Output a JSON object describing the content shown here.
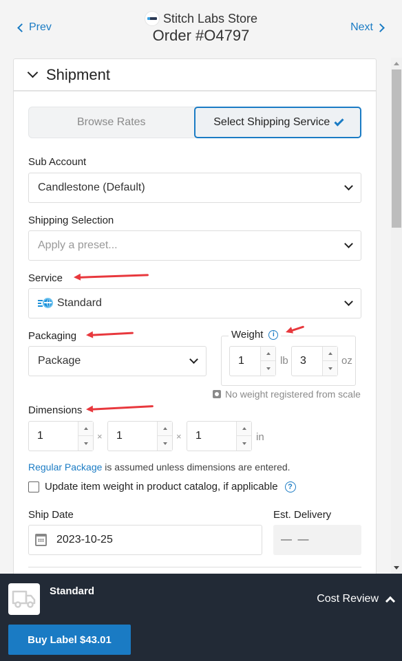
{
  "header": {
    "prev_label": "Prev",
    "next_label": "Next",
    "store_name": "Stitch Labs Store",
    "order_title": "Order #O4797"
  },
  "panel": {
    "title": "Shipment",
    "tabs": [
      {
        "label": "Browse Rates",
        "active": false
      },
      {
        "label": "Select Shipping Service",
        "active": true
      }
    ]
  },
  "form": {
    "sub_account": {
      "label": "Sub Account",
      "value": "Candlestone (Default)"
    },
    "shipping_selection": {
      "label": "Shipping Selection",
      "placeholder": "Apply a preset..."
    },
    "service": {
      "label": "Service",
      "value": "Standard"
    },
    "packaging": {
      "label": "Packaging",
      "value": "Package"
    },
    "weight": {
      "label": "Weight",
      "lb_value": "1",
      "lb_unit": "lb",
      "oz_value": "3",
      "oz_unit": "oz",
      "scale_note": "No weight registered from scale"
    },
    "dimensions": {
      "label": "Dimensions",
      "length": "1",
      "width": "1",
      "height": "1",
      "separator": "×",
      "unit": "in"
    },
    "assumed_note": {
      "link": "Regular Package",
      "text": " is assumed unless dimensions are entered."
    },
    "update_weight": {
      "label": "Update item weight in product catalog, if applicable",
      "checked": false
    },
    "ship_date": {
      "label": "Ship Date",
      "value": "2023-10-25"
    },
    "est_delivery": {
      "label": "Est. Delivery",
      "value": "— —"
    }
  },
  "footer": {
    "service_name": "Standard",
    "cost_review_label": "Cost Review",
    "buy_label": "Buy Label $43.01"
  },
  "colors": {
    "accent": "#1a7bc4",
    "footer_bg": "#222a36",
    "annotation_arrow": "#e8383d"
  }
}
